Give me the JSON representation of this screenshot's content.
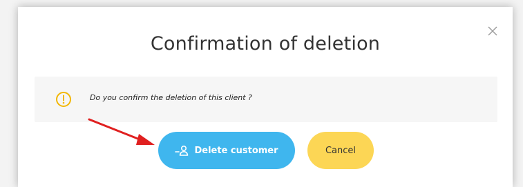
{
  "dialog": {
    "title": "Confirmation of deletion",
    "close_icon": "close-icon",
    "message": "Do you confirm the deletion of this client ?",
    "warning_icon": "warning-circle-icon",
    "delete_button": {
      "label": "Delete customer",
      "icon": "remove-user-icon",
      "color": "#3fb6ee"
    },
    "cancel_button": {
      "label": "Cancel",
      "color": "#fcd655"
    }
  },
  "annotation": {
    "arrow_color": "#e02020",
    "points_to": "delete_button"
  },
  "colors": {
    "warning": "#f2b705",
    "alert_bg": "#f6f6f6"
  }
}
